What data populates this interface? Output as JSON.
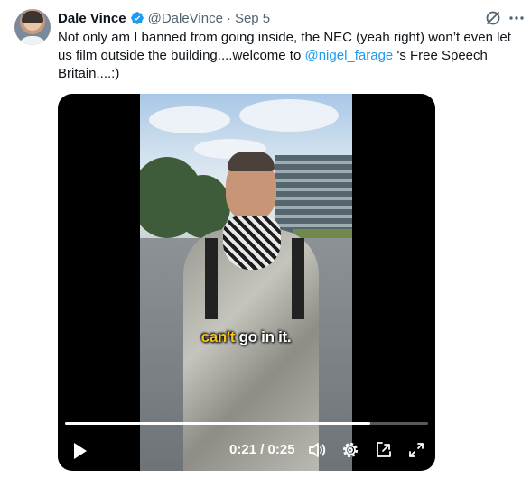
{
  "tweet": {
    "author_name": "Dale Vince",
    "handle": "@DaleVince",
    "separator": "·",
    "date": "Sep 5",
    "text_part1": "Not only am I banned from going inside, the NEC (yeah right) won’t even let us film outside the building....welcome to ",
    "mention": "@nigel_farage",
    "text_part2": " 's Free Speech Britain....:)"
  },
  "video": {
    "caption_highlight": "can't",
    "caption_rest": " go in it.",
    "current_time": "0:21",
    "time_separator": " / ",
    "duration": "0:25",
    "progress_fraction": 0.84
  },
  "icons": {
    "verified": "verified-badge-icon",
    "grok": "grok-icon",
    "more": "more-icon",
    "play": "play-icon",
    "volume": "volume-icon",
    "settings": "settings-icon",
    "pip": "picture-in-picture-icon",
    "fullscreen": "fullscreen-icon"
  },
  "colors": {
    "link": "#1d9bf0",
    "secondary_text": "#536471",
    "caption_highlight": "#f5c518"
  }
}
